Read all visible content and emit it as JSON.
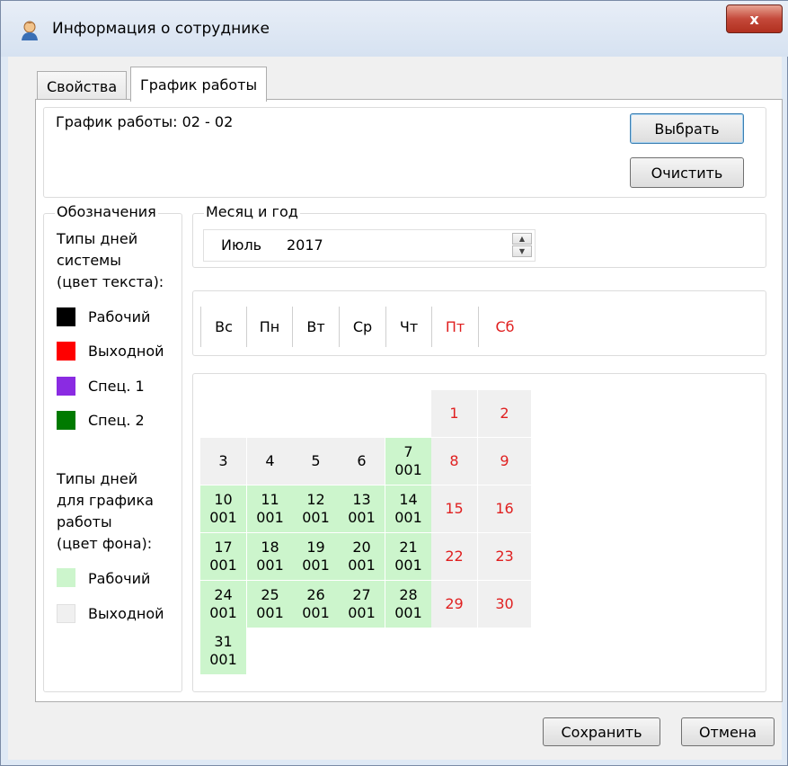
{
  "window": {
    "title": "Информация о сотруднике",
    "close_label": "x"
  },
  "tabs": [
    {
      "label": "Свойства",
      "active": false
    },
    {
      "label": "График работы",
      "active": true
    }
  ],
  "schedule": {
    "label": "График работы:",
    "value": "02 - 02",
    "select_button": "Выбрать",
    "clear_button": "Очистить"
  },
  "legend": {
    "title": "Обозначения",
    "system_types_label": [
      "Типы дней",
      "системы",
      "(цвет текста):"
    ],
    "system_types": [
      {
        "label": "Рабочий",
        "color": "#000000"
      },
      {
        "label": "Выходной",
        "color": "#ff0000"
      },
      {
        "label": "Спец. 1",
        "color": "#8a2be2"
      },
      {
        "label": "Спец. 2",
        "color": "#007a00"
      }
    ],
    "schedule_types_label": [
      "Типы дней",
      "для графика",
      "работы",
      "(цвет фона):"
    ],
    "schedule_types": [
      {
        "label": "Рабочий",
        "color": "#ccf5cc"
      },
      {
        "label": "Выходной",
        "color": "#f0f0f0"
      }
    ]
  },
  "month_year": {
    "title": "Месяц и год",
    "month": "Июль",
    "year": "2017"
  },
  "weekdays": [
    {
      "label": "Вс",
      "weekend": false
    },
    {
      "label": "Пн",
      "weekend": false
    },
    {
      "label": "Вт",
      "weekend": false
    },
    {
      "label": "Ср",
      "weekend": false
    },
    {
      "label": "Чт",
      "weekend": false
    },
    {
      "label": "Пт",
      "weekend": true
    },
    {
      "label": "Сб",
      "weekend": true
    }
  ],
  "calendar": {
    "first_weekday_index": 5,
    "days": [
      {
        "day": "1",
        "code": "",
        "work": false,
        "weekend": true
      },
      {
        "day": "2",
        "code": "",
        "work": false,
        "weekend": true
      },
      {
        "day": "3",
        "code": "",
        "work": false,
        "weekend": false
      },
      {
        "day": "4",
        "code": "",
        "work": false,
        "weekend": false
      },
      {
        "day": "5",
        "code": "",
        "work": false,
        "weekend": false
      },
      {
        "day": "6",
        "code": "",
        "work": false,
        "weekend": false
      },
      {
        "day": "7",
        "code": "001",
        "work": true,
        "weekend": false
      },
      {
        "day": "8",
        "code": "",
        "work": false,
        "weekend": true
      },
      {
        "day": "9",
        "code": "",
        "work": false,
        "weekend": true
      },
      {
        "day": "10",
        "code": "001",
        "work": true,
        "weekend": false
      },
      {
        "day": "11",
        "code": "001",
        "work": true,
        "weekend": false
      },
      {
        "day": "12",
        "code": "001",
        "work": true,
        "weekend": false
      },
      {
        "day": "13",
        "code": "001",
        "work": true,
        "weekend": false
      },
      {
        "day": "14",
        "code": "001",
        "work": true,
        "weekend": false
      },
      {
        "day": "15",
        "code": "",
        "work": false,
        "weekend": true
      },
      {
        "day": "16",
        "code": "",
        "work": false,
        "weekend": true
      },
      {
        "day": "17",
        "code": "001",
        "work": true,
        "weekend": false
      },
      {
        "day": "18",
        "code": "001",
        "work": true,
        "weekend": false
      },
      {
        "day": "19",
        "code": "001",
        "work": true,
        "weekend": false
      },
      {
        "day": "20",
        "code": "001",
        "work": true,
        "weekend": false
      },
      {
        "day": "21",
        "code": "001",
        "work": true,
        "weekend": false
      },
      {
        "day": "22",
        "code": "",
        "work": false,
        "weekend": true
      },
      {
        "day": "23",
        "code": "",
        "work": false,
        "weekend": true
      },
      {
        "day": "24",
        "code": "001",
        "work": true,
        "weekend": false
      },
      {
        "day": "25",
        "code": "001",
        "work": true,
        "weekend": false
      },
      {
        "day": "26",
        "code": "001",
        "work": true,
        "weekend": false
      },
      {
        "day": "27",
        "code": "001",
        "work": true,
        "weekend": false
      },
      {
        "day": "28",
        "code": "001",
        "work": true,
        "weekend": false
      },
      {
        "day": "29",
        "code": "",
        "work": false,
        "weekend": true
      },
      {
        "day": "30",
        "code": "",
        "work": false,
        "weekend": true
      },
      {
        "day": "31",
        "code": "001",
        "work": true,
        "weekend": false
      }
    ]
  },
  "footer": {
    "save_button": "Сохранить",
    "cancel_button": "Отмена"
  }
}
